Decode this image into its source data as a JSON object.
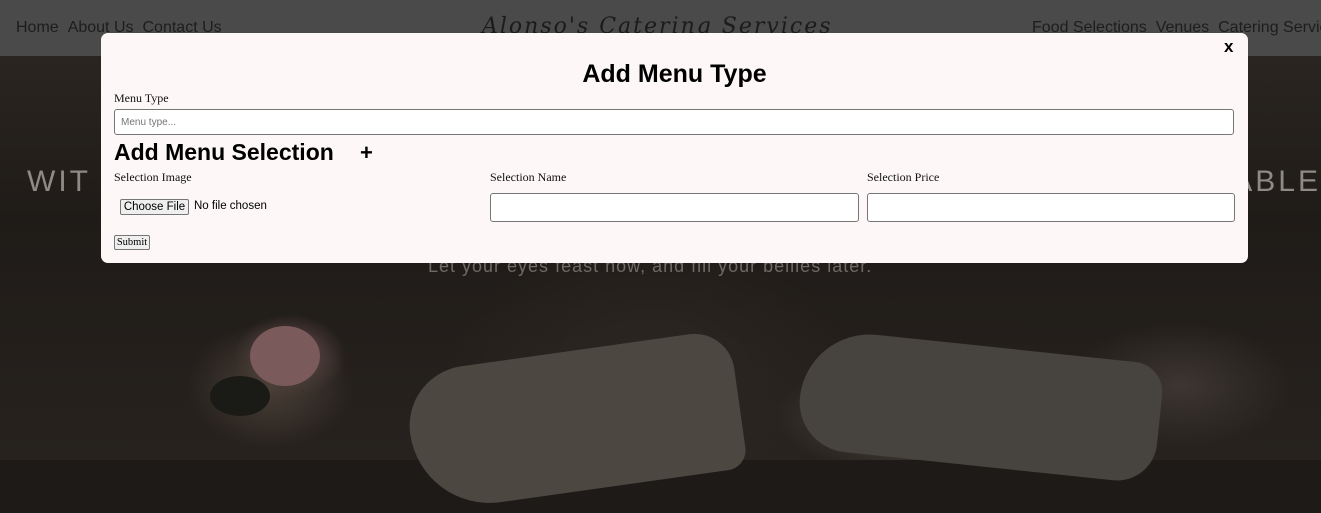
{
  "navbar": {
    "left_links": [
      "Home",
      "About Us",
      "Contact Us"
    ],
    "brand": "Alonso's Catering Services",
    "right_links": [
      "Food Selections",
      "Venues",
      "Catering Service"
    ]
  },
  "hero": {
    "title_left": "WIT",
    "title_right": "ABLE",
    "tagline": "Let your eyes feast now, and fill your bellies later."
  },
  "modal": {
    "close_label": "x",
    "title": "Add Menu Type",
    "menu_type_label": "Menu Type",
    "menu_type_placeholder": "Menu type...",
    "menu_type_value": "",
    "section_title": "Add Menu Selection",
    "add_selection_label": "+",
    "selection_image_label": "Selection Image",
    "choose_file_label": "Choose File",
    "file_status": "No file chosen",
    "selection_name_label": "Selection Name",
    "selection_name_value": "",
    "selection_price_label": "Selection Price",
    "selection_price_value": "",
    "submit_label": "Submit"
  }
}
